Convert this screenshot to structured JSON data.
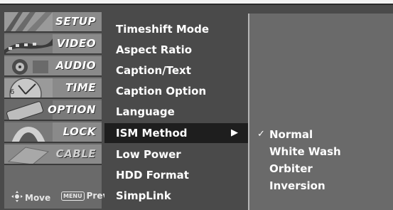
{
  "categories": [
    {
      "label": "SETUP"
    },
    {
      "label": "VIDEO"
    },
    {
      "label": "AUDIO"
    },
    {
      "label": "TIME"
    },
    {
      "label": "OPTION"
    },
    {
      "label": "LOCK"
    },
    {
      "label": "CABLE"
    }
  ],
  "hint": {
    "move_label": "Move",
    "menu_key": "MENU",
    "prev_label": "Prev"
  },
  "submenu": {
    "items": [
      {
        "label": "Timeshift Mode"
      },
      {
        "label": "Aspect Ratio"
      },
      {
        "label": "Caption/Text"
      },
      {
        "label": "Caption Option"
      },
      {
        "label": "Language"
      },
      {
        "label": "ISM Method"
      },
      {
        "label": "Low Power"
      },
      {
        "label": "HDD Format"
      },
      {
        "label": "SimpLink"
      }
    ],
    "selected_index": 5,
    "arrow": "▶"
  },
  "options": {
    "items": [
      {
        "label": "Normal",
        "checked": true
      },
      {
        "label": "White Wash",
        "checked": false
      },
      {
        "label": "Orbiter",
        "checked": false
      },
      {
        "label": "Inversion",
        "checked": false
      }
    ],
    "check_glyph": "✓"
  },
  "colors": {
    "menu_bg": "#4a4a4a",
    "option_bg": "#6a6a6a",
    "selected_bg": "#1e1e1e",
    "text": "#ffffff"
  }
}
